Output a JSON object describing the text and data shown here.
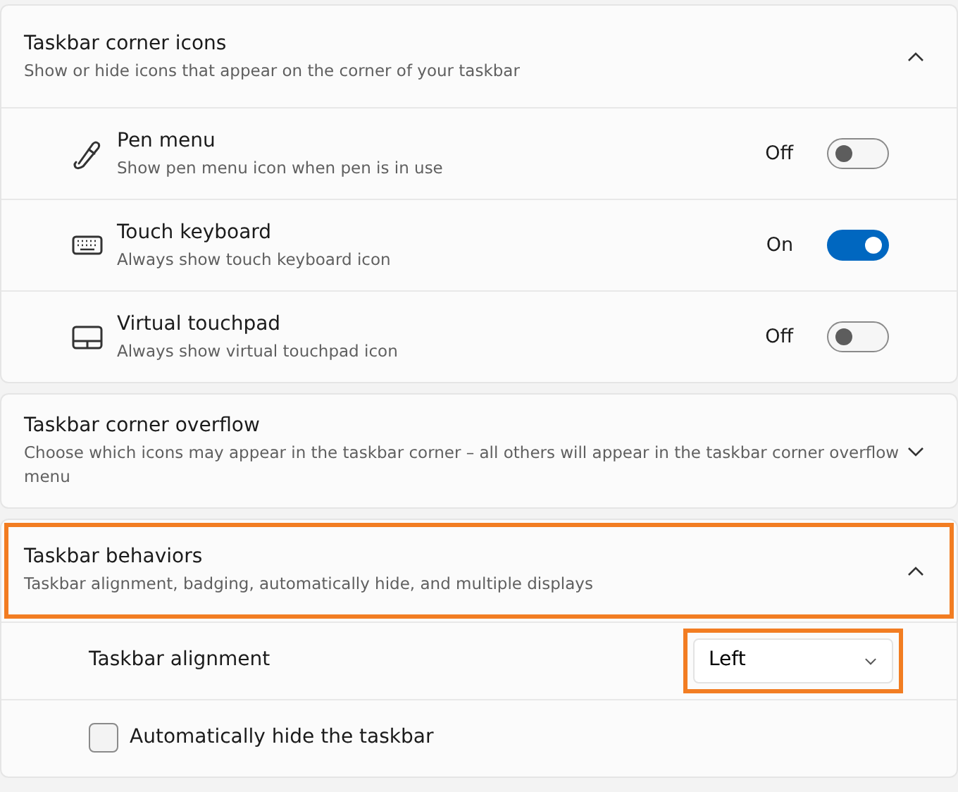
{
  "sections": [
    {
      "title": "Taskbar corner icons",
      "description": "Show or hide icons that appear on the corner of your taskbar",
      "expanded": true,
      "highlighted": false,
      "items": [
        {
          "kind": "toggle",
          "title": "Pen menu",
          "description": "Show pen menu icon when pen is in use",
          "state_label": "Off",
          "on": false
        },
        {
          "kind": "toggle",
          "title": "Touch keyboard",
          "description": "Always show touch keyboard icon",
          "state_label": "On",
          "on": true
        },
        {
          "kind": "toggle",
          "title": "Virtual touchpad",
          "description": "Always show virtual touchpad icon",
          "state_label": "Off",
          "on": false
        }
      ]
    },
    {
      "title": "Taskbar corner overflow",
      "description": "Choose which icons may appear in the taskbar corner – all others will appear in the taskbar corner overflow menu",
      "expanded": false,
      "highlighted": false
    },
    {
      "title": "Taskbar behaviors",
      "description": "Taskbar alignment, badging, automatically hide, and multiple displays",
      "expanded": true,
      "highlighted": true,
      "items": [
        {
          "kind": "dropdown",
          "label": "Taskbar alignment",
          "value": "Left",
          "highlighted": true
        },
        {
          "kind": "checkbox",
          "label": "Automatically hide the taskbar",
          "checked": false
        }
      ]
    }
  ]
}
